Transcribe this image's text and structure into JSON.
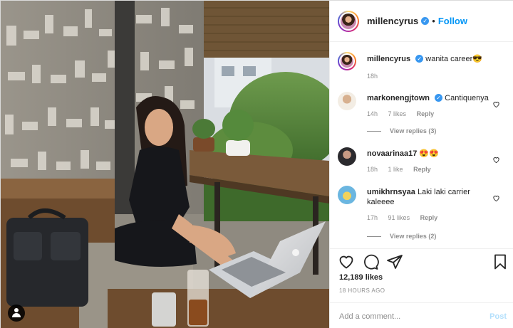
{
  "post": {
    "author": "millencyrus",
    "verified": true,
    "follow_label": "Follow",
    "separator": "•",
    "caption": {
      "user": "millencyrus",
      "text": "wanita career😎",
      "age": "18h"
    }
  },
  "comments": [
    {
      "user": "markonengjtown",
      "verified": true,
      "text": "Cantiquenya",
      "age": "14h",
      "likes": "7 likes",
      "reply_label": "Reply",
      "view_replies": "View replies (3)"
    },
    {
      "user": "novaarinaa17",
      "verified": false,
      "text": "😍😍",
      "age": "18h",
      "likes": "1 like",
      "reply_label": "Reply",
      "view_replies": ""
    },
    {
      "user": "umikhrnsyaa",
      "verified": false,
      "text": "Laki laki carrier kaleeee",
      "age": "17h",
      "likes": "91 likes",
      "reply_label": "Reply",
      "view_replies": "View replies (2)"
    }
  ],
  "actions": {
    "likes": "12,189 likes",
    "timestamp": "18 HOURS AGO",
    "comment_placeholder": "Add a comment...",
    "post_label": "Post"
  },
  "icons": {
    "like": "heart-icon",
    "comment": "comment-icon",
    "share": "share-icon",
    "save": "bookmark-icon",
    "tag": "user-tag-icon"
  },
  "colors": {
    "link": "#0095f6",
    "verified": "#3897f0",
    "muted": "#8e8e8e",
    "text": "#262626",
    "border": "#efefef"
  }
}
